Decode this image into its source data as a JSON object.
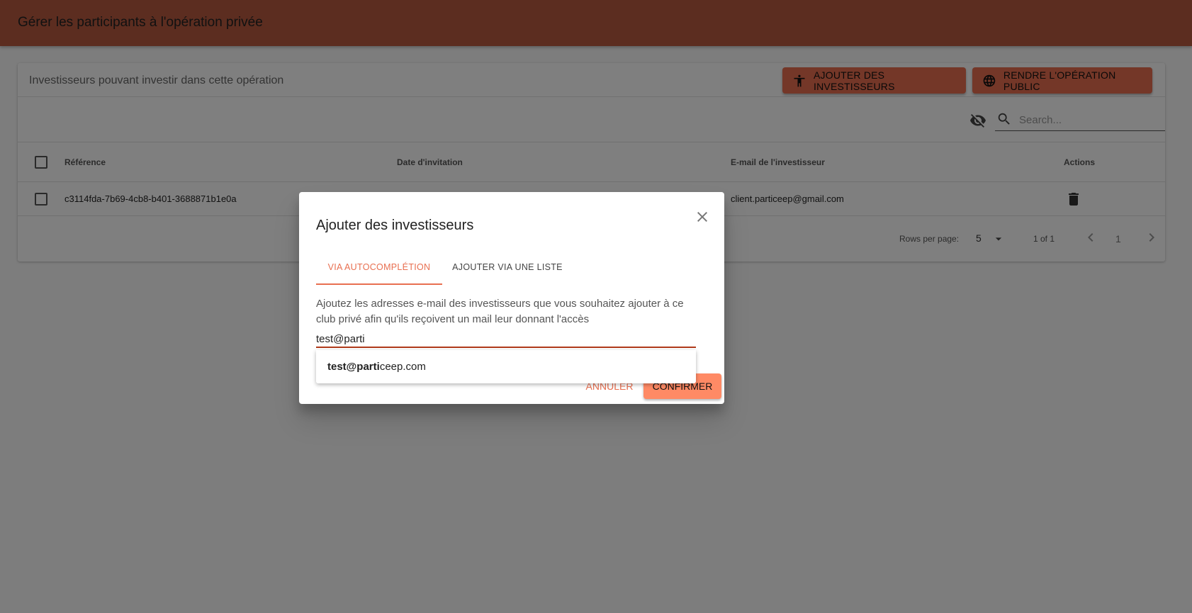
{
  "appbar": {
    "title": "Gérer les participants à l'opération privée"
  },
  "card": {
    "title": "Investisseurs pouvant investir dans cette opération",
    "add_investors_label": "AJOUTER DES INVESTISSEURS",
    "make_public_label": "RENDRE L'OPÉRATION PUBLIC"
  },
  "toolbar": {
    "search_placeholder": "Search..."
  },
  "table": {
    "columns": [
      "Référence",
      "Date d'invitation",
      "E-mail de l'investisseur",
      "Actions"
    ],
    "rows": [
      {
        "reference": "c3114fda-7b69-4cb8-b401-3688871b1e0a",
        "date": "",
        "email": "client.particeep@gmail.com"
      }
    ]
  },
  "pagination": {
    "rows_per_page_label": "Rows per page:",
    "rows_per_page": "5",
    "range": "1 of 1",
    "page": "1"
  },
  "dialog": {
    "title": "Ajouter des investisseurs",
    "tabs": [
      {
        "label": "VIA AUTOCOMPLÉTION",
        "active": true
      },
      {
        "label": "AJOUTER VIA UNE LISTE",
        "active": false
      }
    ],
    "description": "Ajoutez les adresses e-mail des investisseurs que vous souhaitez ajouter à ce club privé afin qu'ils reçoivent un mail leur donnant l'accès",
    "input_value": "test@parti",
    "cancel_label": "ANNULER",
    "confirm_label": "CONFIRMER"
  },
  "autocomplete": {
    "suggestions": [
      {
        "match": "test@parti",
        "rest": "ceep.com"
      }
    ]
  },
  "colors": {
    "appbar": "#b85a40",
    "primary": "#e86f50",
    "confirm": "#ff8a65",
    "input_underline": "#b03a1a"
  },
  "icons": [
    "accessibility-icon",
    "globe-icon",
    "eye-off-icon",
    "search-icon",
    "delete-icon",
    "arrow-drop-down-icon",
    "chevron-left-icon",
    "chevron-right-icon",
    "close-icon"
  ]
}
